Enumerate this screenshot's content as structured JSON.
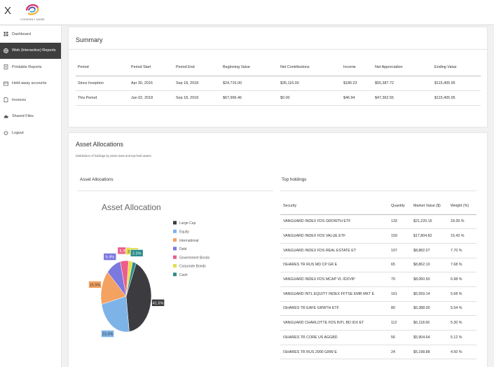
{
  "header": {
    "close_label": "X",
    "company_name": "COMPANY NAME"
  },
  "sidebar": {
    "items": [
      {
        "label": "Dashboard",
        "icon": "dashboard-icon",
        "active": false
      },
      {
        "label": "Web (Interactive) Reports",
        "icon": "globe-icon",
        "active": true
      },
      {
        "label": "Printable Reports",
        "icon": "document-icon",
        "active": false
      },
      {
        "label": "Held-away accounts",
        "icon": "account-icon",
        "active": false
      },
      {
        "label": "Invoices",
        "icon": "invoice-icon",
        "active": false
      },
      {
        "label": "Shared Files",
        "icon": "cloud-icon",
        "active": false
      },
      {
        "label": "Logout",
        "icon": "power-icon",
        "active": false
      }
    ]
  },
  "summary": {
    "title": "Summary",
    "columns": [
      "Period",
      "Period Start",
      "Period End",
      "Beginning Value",
      "Net Contributions",
      "Income",
      "Net Appreciation",
      "Ending Value"
    ],
    "rows": [
      [
        "Since Inception",
        "Apr 30, 2016",
        "Sep 18, 2018",
        "$24,716.00",
        "$35,116.00",
        "$186.23",
        "$55,387.72",
        "$115,405.95"
      ],
      [
        "This Period",
        "Jan 02, 2018",
        "Sep 18, 2018",
        "$67,996.46",
        "$0.00",
        "$46.94",
        "$47,362.55",
        "$115,405.95"
      ]
    ]
  },
  "allocations": {
    "title": "Asset Allocations",
    "description": "Distribution of holdings by asset class and top-held assets.",
    "chart_section_label": "Asset Allocations",
    "holdings_section_label": "Top holdings"
  },
  "chart_data": {
    "type": "pie",
    "title": "Asset Allocation",
    "legend_position": "right",
    "categories": [
      "Large Cap",
      "Equity",
      "International",
      "Debt",
      "Government Bonds",
      "Corporate Bonds",
      "Cash"
    ],
    "values": [
      41.5,
      23.3,
      15.5,
      9.4,
      5.3,
      2.6,
      2.3
    ],
    "labels": [
      "41.5%",
      "23.3%",
      "15.5%",
      "9.4%",
      "5.3%",
      "2.6%",
      "2.3%"
    ],
    "colors": [
      "#3c3b3f",
      "#7eb3e8",
      "#f4a261",
      "#7b78e0",
      "#ee5d8a",
      "#e6df4a",
      "#2d8b8b"
    ]
  },
  "holdings": {
    "columns": [
      "Security",
      "Quantity",
      "Market Value ($)",
      "Weight (%)"
    ],
    "rows": [
      [
        "VANGUARD INDEX FDS GROWTH ETF",
        "133",
        "$21,220.15",
        "18.39 %"
      ],
      [
        "VANGUARD INDEX FDS VALUE ETF",
        "159",
        "$17,804.82",
        "15.43 %"
      ],
      [
        "VANGUARD INDEX FDS REAL ESTATE ET",
        "107",
        "$8,882.07",
        "7.70 %"
      ],
      [
        "ISHARES TR RUS MD CP GR E",
        "65",
        "$8,862.10",
        "7.68 %"
      ],
      [
        "VANGUARD INDEX FDS MCAP VL IDXVIP",
        "70",
        "$8,060.50",
        "6.98 %"
      ],
      [
        "VANGUARD INTL EQUITY INDEX FFTSE EMR MKT E",
        "161",
        "$6,559.14",
        "5.68 %"
      ],
      [
        "ISHARES TR EAFE GRWTH ETF",
        "80",
        "$6,388.00",
        "5.54 %"
      ],
      [
        "VANGUARD CHARLOTTE FDS INTL BD IDX ET",
        "112",
        "$6,118.56",
        "5.30 %"
      ],
      [
        "ISHARES TR CORE US AGGBD",
        "56",
        "$5,904.64",
        "5.12 %"
      ],
      [
        "ISHARES TR RUS 2000 GRW E",
        "24",
        "$5,198.88",
        "4.50 %"
      ]
    ]
  }
}
